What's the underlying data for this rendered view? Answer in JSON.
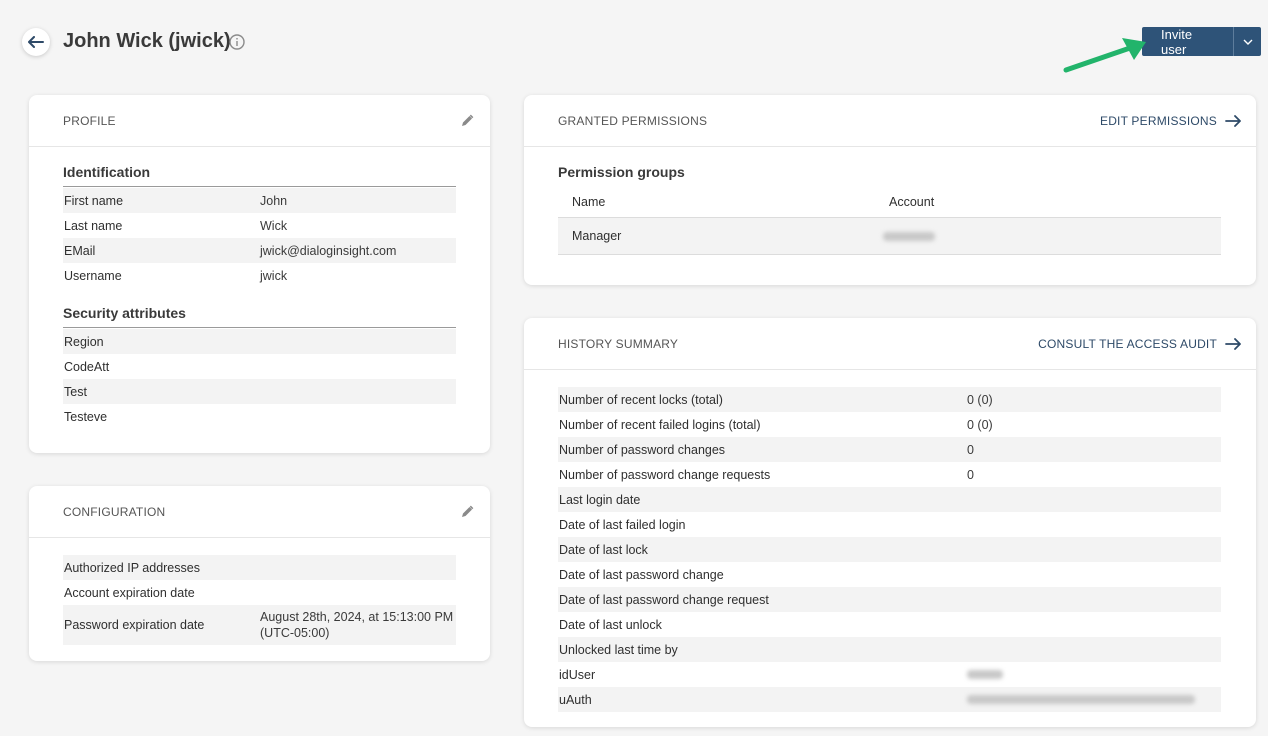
{
  "header": {
    "title": "John Wick (jwick)",
    "invite_label": "Invite user"
  },
  "profile": {
    "card_title": "PROFILE",
    "identification_title": "Identification",
    "identification": [
      {
        "label": "First name",
        "value": "John"
      },
      {
        "label": "Last name",
        "value": "Wick"
      },
      {
        "label": "EMail",
        "value": "jwick@dialoginsight.com"
      },
      {
        "label": "Username",
        "value": "jwick"
      }
    ],
    "security_title": "Security attributes",
    "security": [
      {
        "label": "Region",
        "value": ""
      },
      {
        "label": "CodeAtt",
        "value": ""
      },
      {
        "label": "Test",
        "value": ""
      },
      {
        "label": "Testeve",
        "value": ""
      }
    ]
  },
  "configuration": {
    "card_title": "CONFIGURATION",
    "rows": [
      {
        "label": "Authorized IP addresses",
        "value": ""
      },
      {
        "label": "Account expiration date",
        "value": ""
      },
      {
        "label": "Password expiration date",
        "value": "August 28th, 2024, at 15:13:00 PM",
        "value2": "(UTC-05:00)"
      }
    ]
  },
  "permissions": {
    "card_title": "GRANTED PERMISSIONS",
    "action_label": "EDIT PERMISSIONS",
    "groups_title": "Permission groups",
    "columns": [
      "Name",
      "Account"
    ],
    "rows": [
      {
        "name": "Manager"
      }
    ]
  },
  "history": {
    "card_title": "HISTORY SUMMARY",
    "action_label": "CONSULT THE ACCESS AUDIT",
    "rows": [
      {
        "label": "Number of recent locks (total)",
        "value": "0 (0)"
      },
      {
        "label": "Number of recent failed logins (total)",
        "value": "0 (0)"
      },
      {
        "label": "Number of password changes",
        "value": "0"
      },
      {
        "label": "Number of password change requests",
        "value": "0"
      },
      {
        "label": "Last login date",
        "value": ""
      },
      {
        "label": "Date of last failed login",
        "value": ""
      },
      {
        "label": "Date of last lock",
        "value": ""
      },
      {
        "label": "Date of last password change",
        "value": ""
      },
      {
        "label": "Date of last password change request",
        "value": ""
      },
      {
        "label": "Date of last unlock",
        "value": ""
      },
      {
        "label": "Unlocked last time by",
        "value": ""
      },
      {
        "label": "idUser",
        "value": ""
      },
      {
        "label": "uAuth",
        "value": ""
      }
    ]
  },
  "colors": {
    "accent": "#2e5378",
    "annotation_arrow": "#22b46b"
  }
}
